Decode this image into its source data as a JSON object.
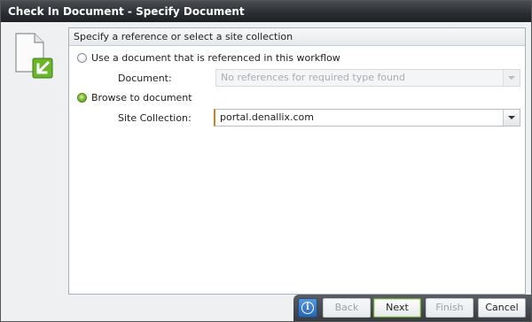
{
  "window": {
    "title": "Check In Document - Specify Document"
  },
  "panel": {
    "header": "Specify a reference or select a site collection"
  },
  "options": {
    "use_reference_label": "Use a document that is referenced in this workflow",
    "document_label": "Document:",
    "document_value": "No references for required type found",
    "browse_label": "Browse to document",
    "site_collection_label": "Site Collection:",
    "site_collection_value": "portal.denallix.com"
  },
  "footer": {
    "help_glyph": "i",
    "back_label": "Back",
    "next_label": "Next",
    "finish_label": "Finish",
    "cancel_label": "Cancel"
  },
  "icons": {
    "document": "document-checkin-icon",
    "help": "info-icon",
    "dropdown": "chevron-down-icon"
  },
  "colors": {
    "accent_green": "#7cc033",
    "focus_orange": "#e07a1f",
    "titlebar": "#2c2f33"
  }
}
